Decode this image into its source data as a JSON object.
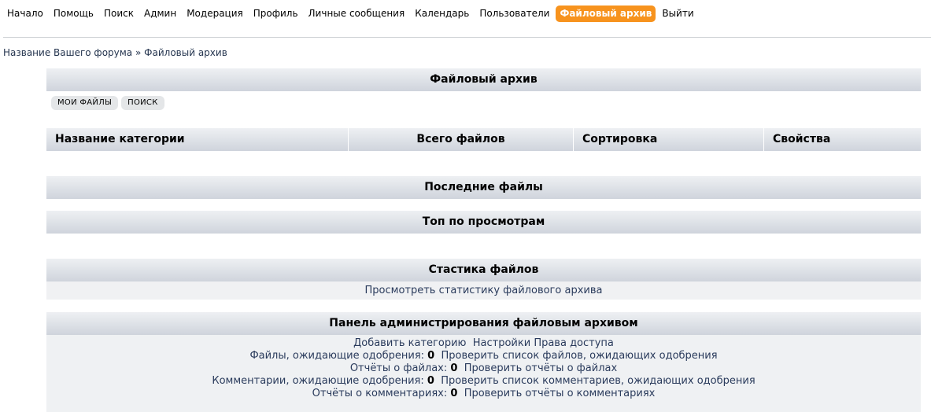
{
  "nav": [
    {
      "label": "Начало",
      "active": false
    },
    {
      "label": "Помощь",
      "active": false
    },
    {
      "label": "Поиск",
      "active": false
    },
    {
      "label": "Админ",
      "active": false
    },
    {
      "label": "Модерация",
      "active": false
    },
    {
      "label": "Профиль",
      "active": false
    },
    {
      "label": "Личные сообщения",
      "active": false
    },
    {
      "label": "Календарь",
      "active": false
    },
    {
      "label": "Пользователи",
      "active": false
    },
    {
      "label": "Файловый архив",
      "active": true
    },
    {
      "label": "Выйти",
      "active": false
    }
  ],
  "breadcrumb": {
    "forum": "Название Вашего форума",
    "sep": "»",
    "current": "Файловый архив"
  },
  "archive": {
    "title": "Файловый архив",
    "buttons": {
      "my_files": "МОИ ФАЙЛЫ",
      "search": "ПОИСК"
    },
    "columns": {
      "name": "Название категории",
      "total": "Всего файлов",
      "sort": "Сортировка",
      "props": "Свойства"
    }
  },
  "sections": {
    "latest": "Последние файлы",
    "top": "Топ по просмотрам",
    "stats_title": "Стастика файлов",
    "stats_link": "Просмотреть статистику файлового архива"
  },
  "admin": {
    "title": "Панель администрирования файловым архивом",
    "add_category": "Добавить категорию",
    "settings": "Настройки",
    "permissions": "Права доступа",
    "pending_files_label": "Файлы, ожидающие одобрения:",
    "pending_files_count": "0",
    "pending_files_link": "Проверить список файлов, ожидающих одобрения",
    "file_reports_label": "Отчёты о файлах:",
    "file_reports_count": "0",
    "file_reports_link": "Проверить отчёты о файлах",
    "pending_comments_label": "Комментарии, ожидающие одобрения:",
    "pending_comments_count": "0",
    "pending_comments_link": "Проверить список комментариев, ожидающих одобрения",
    "comment_reports_label": "Отчёты о комментариях:",
    "comment_reports_count": "0",
    "comment_reports_link": "Проверить отчёты о комментариях"
  },
  "colors": {
    "accent": "#f7931e",
    "header_gradient_top": "#eef0f3",
    "header_gradient_bottom": "#cfd4dc",
    "link": "#2a3b5c"
  }
}
